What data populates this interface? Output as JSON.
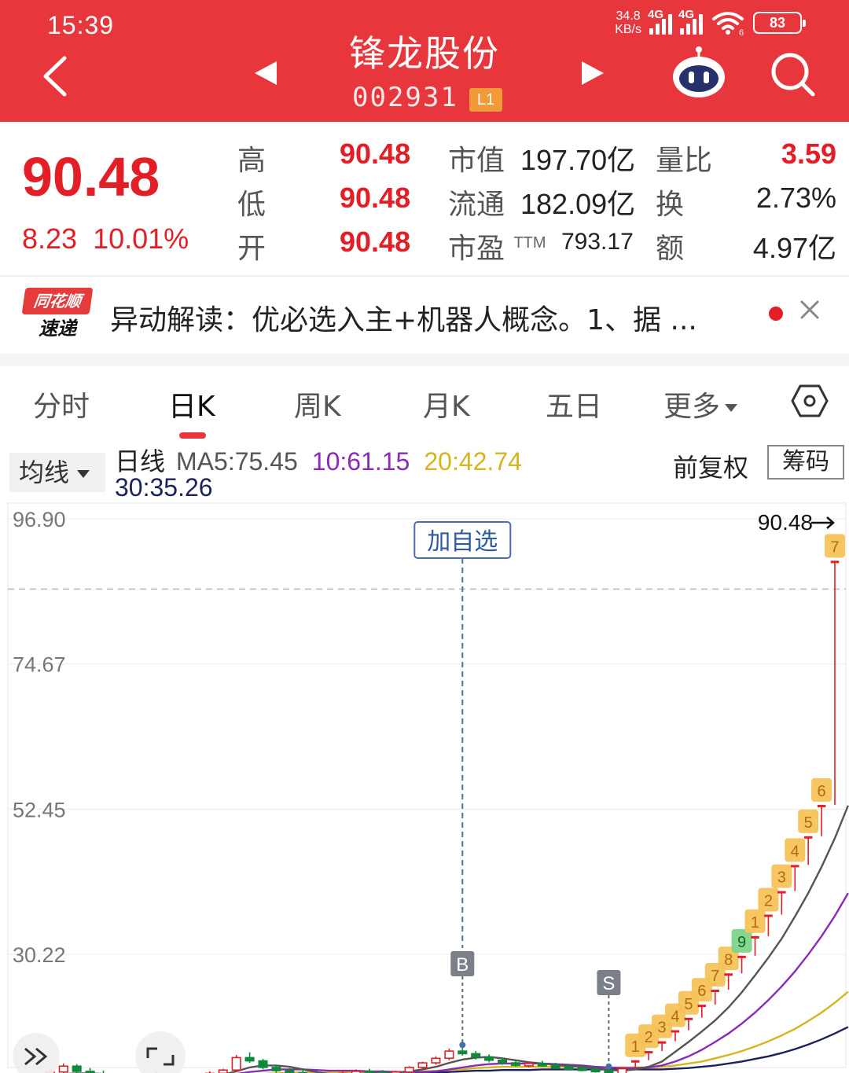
{
  "status_bar": {
    "time": "15:39",
    "net_speed_value": "34.8",
    "net_speed_unit": "KB/s",
    "network_1": "4G",
    "network_2": "4G",
    "wifi_badge": "6",
    "battery": "83"
  },
  "header": {
    "stock_name": "锋龙股份",
    "stock_code": "002931",
    "level_badge": "L1"
  },
  "quote": {
    "price": "90.48",
    "change": "8.23",
    "change_pct": "10.01%",
    "high_label": "高",
    "high": "90.48",
    "low_label": "低",
    "low": "90.48",
    "open_label": "开",
    "open": "90.48",
    "mcap_label": "市值",
    "mcap": "197.70亿",
    "float_label": "流通",
    "float": "182.09亿",
    "pe_label": "市盈",
    "pe_sup": "TTM",
    "pe": "793.17",
    "vol_ratio_label": "量比",
    "vol_ratio": "3.59",
    "turnover_label": "换",
    "turnover": "2.73%",
    "amount_label": "额",
    "amount": "4.97亿"
  },
  "news": {
    "logo_top": "同花顺",
    "logo_bottom": "速递",
    "text": "异动解读：优必选入主+机器人概念。1、据 ..."
  },
  "tabs": {
    "t1": "分时",
    "t2": "日K",
    "t3": "周K",
    "t4": "月K",
    "t5": "五日",
    "t6": "更多"
  },
  "ma_row": {
    "select_label": "均线",
    "name": "日线",
    "ma5": "MA5:75.45",
    "ma10": "10:61.15",
    "ma20": "20:42.74",
    "ma30": "30:35.26",
    "adjust_label": "前复权",
    "chips_button": "筹码"
  },
  "colors": {
    "brand": "#e8373c",
    "up": "#e21f26",
    "down": "#0e8a3a",
    "ma5": "#555555",
    "ma10": "#8a2ab8",
    "ma20": "#d7b41f",
    "ma30": "#1c2259",
    "badge": "#f6c35a"
  },
  "chart_data": {
    "type": "candlestick",
    "y_ticks": [
      "96.90",
      "74.67",
      "52.45",
      "30.22"
    ],
    "y_tick_values": [
      96.9,
      74.67,
      52.45,
      30.22
    ],
    "ylim": [
      10,
      96.9
    ],
    "price_guide": 90.48,
    "last_price_label": "90.48",
    "add_watch_label": "加自选",
    "buy_marker": {
      "label": "B",
      "index": 33
    },
    "sell_marker": {
      "label": "S",
      "index": 44
    },
    "candles": [
      {
        "o": 10.8,
        "h": 12.0,
        "l": 10.3,
        "c": 11.4
      },
      {
        "o": 11.4,
        "h": 11.9,
        "l": 10.6,
        "c": 10.9
      },
      {
        "o": 10.9,
        "h": 12.6,
        "l": 10.7,
        "c": 12.2
      },
      {
        "o": 12.2,
        "h": 13.5,
        "l": 11.8,
        "c": 13.1
      },
      {
        "o": 13.1,
        "h": 13.4,
        "l": 12.0,
        "c": 12.3
      },
      {
        "o": 12.3,
        "h": 12.8,
        "l": 11.5,
        "c": 11.9
      },
      {
        "o": 11.9,
        "h": 12.4,
        "l": 11.2,
        "c": 11.6
      },
      {
        "o": 11.6,
        "h": 12.0,
        "l": 11.0,
        "c": 11.3
      },
      {
        "o": 11.3,
        "h": 11.8,
        "l": 10.9,
        "c": 11.5
      },
      {
        "o": 11.5,
        "h": 12.1,
        "l": 11.1,
        "c": 11.8
      },
      {
        "o": 11.8,
        "h": 12.2,
        "l": 11.3,
        "c": 11.5
      },
      {
        "o": 11.5,
        "h": 11.9,
        "l": 11.0,
        "c": 11.2
      },
      {
        "o": 11.2,
        "h": 11.7,
        "l": 10.8,
        "c": 11.4
      },
      {
        "o": 11.4,
        "h": 11.9,
        "l": 11.1,
        "c": 11.7
      },
      {
        "o": 11.7,
        "h": 12.3,
        "l": 11.4,
        "c": 12.0
      },
      {
        "o": 12.0,
        "h": 12.7,
        "l": 11.6,
        "c": 12.5
      },
      {
        "o": 12.5,
        "h": 14.8,
        "l": 12.3,
        "c": 14.4
      },
      {
        "o": 14.4,
        "h": 15.2,
        "l": 13.6,
        "c": 13.9
      },
      {
        "o": 13.9,
        "h": 14.2,
        "l": 12.6,
        "c": 12.9
      },
      {
        "o": 12.9,
        "h": 13.3,
        "l": 12.1,
        "c": 12.4
      },
      {
        "o": 12.4,
        "h": 12.8,
        "l": 11.8,
        "c": 12.1
      },
      {
        "o": 12.1,
        "h": 12.6,
        "l": 11.6,
        "c": 11.8
      },
      {
        "o": 11.8,
        "h": 12.2,
        "l": 11.3,
        "c": 11.5
      },
      {
        "o": 11.5,
        "h": 12.0,
        "l": 11.1,
        "c": 11.7
      },
      {
        "o": 11.7,
        "h": 12.3,
        "l": 11.4,
        "c": 12.0
      },
      {
        "o": 12.0,
        "h": 12.6,
        "l": 11.7,
        "c": 12.3
      },
      {
        "o": 12.3,
        "h": 12.7,
        "l": 11.9,
        "c": 12.1
      },
      {
        "o": 12.1,
        "h": 12.5,
        "l": 11.6,
        "c": 11.9
      },
      {
        "o": 11.9,
        "h": 12.4,
        "l": 11.5,
        "c": 12.2
      },
      {
        "o": 12.2,
        "h": 13.1,
        "l": 12.0,
        "c": 12.9
      },
      {
        "o": 12.9,
        "h": 13.8,
        "l": 12.6,
        "c": 13.6
      },
      {
        "o": 13.6,
        "h": 14.6,
        "l": 13.3,
        "c": 14.3
      },
      {
        "o": 14.3,
        "h": 15.8,
        "l": 14.0,
        "c": 15.4
      },
      {
        "o": 15.4,
        "h": 16.1,
        "l": 14.7,
        "c": 15.0
      },
      {
        "o": 15.0,
        "h": 15.4,
        "l": 14.1,
        "c": 14.5
      },
      {
        "o": 14.5,
        "h": 14.9,
        "l": 13.7,
        "c": 14.0
      },
      {
        "o": 14.0,
        "h": 14.4,
        "l": 13.3,
        "c": 13.6
      },
      {
        "o": 13.6,
        "h": 14.0,
        "l": 13.0,
        "c": 13.3
      },
      {
        "o": 13.3,
        "h": 13.8,
        "l": 12.9,
        "c": 13.5
      },
      {
        "o": 13.5,
        "h": 13.9,
        "l": 13.0,
        "c": 13.2
      },
      {
        "o": 13.2,
        "h": 13.6,
        "l": 12.8,
        "c": 13.0
      },
      {
        "o": 13.0,
        "h": 13.4,
        "l": 12.5,
        "c": 12.8
      },
      {
        "o": 12.8,
        "h": 13.2,
        "l": 12.3,
        "c": 12.6
      },
      {
        "o": 12.6,
        "h": 13.0,
        "l": 12.1,
        "c": 12.4
      },
      {
        "o": 12.4,
        "h": 12.8,
        "l": 11.1,
        "c": 11.5
      },
      {
        "o": 11.5,
        "h": 12.9,
        "l": 11.3,
        "c": 12.7
      },
      {
        "o": 12.7,
        "h": 14.0,
        "l": 12.7,
        "c": 14.0,
        "badge": "1"
      },
      {
        "o": 14.0,
        "h": 15.4,
        "l": 14.0,
        "c": 15.4,
        "badge": "2"
      },
      {
        "o": 15.4,
        "h": 16.9,
        "l": 15.4,
        "c": 16.9,
        "badge": "3"
      },
      {
        "o": 16.9,
        "h": 18.6,
        "l": 16.9,
        "c": 18.6,
        "badge": "4"
      },
      {
        "o": 18.6,
        "h": 20.5,
        "l": 18.6,
        "c": 20.5,
        "badge": "5"
      },
      {
        "o": 20.5,
        "h": 22.5,
        "l": 20.5,
        "c": 22.5,
        "badge": "6"
      },
      {
        "o": 22.5,
        "h": 24.8,
        "l": 22.5,
        "c": 24.8,
        "badge": "7"
      },
      {
        "o": 24.8,
        "h": 27.3,
        "l": 24.8,
        "c": 27.3,
        "badge": "8"
      },
      {
        "o": 27.3,
        "h": 30.0,
        "l": 27.3,
        "c": 30.0,
        "badge": "9",
        "badge_color": "green"
      },
      {
        "o": 30.0,
        "h": 33.0,
        "l": 30.0,
        "c": 33.0,
        "badge": "1"
      },
      {
        "o": 33.0,
        "h": 36.3,
        "l": 33.0,
        "c": 36.3,
        "badge": "2"
      },
      {
        "o": 36.3,
        "h": 39.9,
        "l": 36.3,
        "c": 39.9,
        "badge": "3"
      },
      {
        "o": 39.9,
        "h": 43.9,
        "l": 39.9,
        "c": 43.9,
        "badge": "4"
      },
      {
        "o": 43.9,
        "h": 48.3,
        "l": 43.9,
        "c": 48.3,
        "badge": "5"
      },
      {
        "o": 48.3,
        "h": 53.1,
        "l": 48.3,
        "c": 53.1,
        "badge": "6"
      },
      {
        "o": 53.1,
        "h": 90.48,
        "l": 53.1,
        "c": 90.48,
        "badge": "7"
      }
    ],
    "ma5": [
      11.5,
      11.4,
      11.6,
      11.9,
      12.0,
      12.0,
      11.9,
      11.8,
      11.7,
      11.7,
      11.6,
      11.5,
      11.5,
      11.5,
      11.6,
      11.8,
      12.3,
      12.9,
      13.2,
      13.2,
      13.0,
      12.6,
      12.2,
      11.9,
      11.8,
      11.9,
      12.0,
      12.1,
      12.1,
      12.3,
      12.6,
      13.0,
      13.6,
      14.1,
      14.4,
      14.5,
      14.3,
      14.0,
      13.7,
      13.5,
      13.3,
      13.1,
      13.0,
      12.8,
      12.5,
      12.4,
      12.6,
      13.0,
      13.8,
      15.3,
      16.8,
      18.4,
      20.1,
      22.1,
      24.4,
      27.0,
      29.7,
      32.6,
      36.0,
      39.6,
      43.6,
      48.0,
      53.0
    ],
    "ma10": [
      11.3,
      11.3,
      11.4,
      11.5,
      11.6,
      11.7,
      11.7,
      11.7,
      11.7,
      11.7,
      11.7,
      11.6,
      11.6,
      11.6,
      11.6,
      11.7,
      11.9,
      12.2,
      12.4,
      12.6,
      12.6,
      12.6,
      12.5,
      12.4,
      12.4,
      12.4,
      12.3,
      12.3,
      12.2,
      12.2,
      12.2,
      12.3,
      12.6,
      12.9,
      13.2,
      13.4,
      13.5,
      13.5,
      13.5,
      13.5,
      13.4,
      13.3,
      13.2,
      13.0,
      12.9,
      12.8,
      12.8,
      12.9,
      13.2,
      13.8,
      14.6,
      15.6,
      16.8,
      18.1,
      19.6,
      21.3,
      23.2,
      25.3,
      27.6,
      30.2,
      33.0,
      36.1,
      39.6
    ],
    "ma20": [
      11.0,
      11.0,
      11.1,
      11.2,
      11.3,
      11.3,
      11.4,
      11.4,
      11.4,
      11.5,
      11.5,
      11.5,
      11.5,
      11.5,
      11.5,
      11.6,
      11.7,
      11.8,
      11.9,
      12.0,
      12.1,
      12.1,
      12.1,
      12.1,
      12.1,
      12.2,
      12.2,
      12.2,
      12.2,
      12.2,
      12.3,
      12.4,
      12.5,
      12.6,
      12.8,
      12.9,
      13.0,
      13.0,
      13.0,
      13.0,
      13.0,
      13.0,
      13.0,
      12.9,
      12.9,
      12.9,
      12.9,
      12.9,
      13.0,
      13.2,
      13.5,
      13.8,
      14.3,
      14.8,
      15.4,
      16.1,
      16.9,
      17.8,
      18.8,
      20.0,
      21.3,
      22.8,
      24.5
    ],
    "ma30": [
      10.8,
      10.8,
      10.9,
      11.0,
      11.0,
      11.1,
      11.1,
      11.2,
      11.2,
      11.2,
      11.3,
      11.3,
      11.3,
      11.3,
      11.4,
      11.4,
      11.5,
      11.5,
      11.6,
      11.7,
      11.7,
      11.8,
      11.8,
      11.8,
      11.9,
      11.9,
      11.9,
      12.0,
      12.0,
      12.0,
      12.1,
      12.1,
      12.2,
      12.3,
      12.4,
      12.4,
      12.5,
      12.5,
      12.5,
      12.6,
      12.6,
      12.6,
      12.6,
      12.6,
      12.6,
      12.6,
      12.6,
      12.6,
      12.6,
      12.7,
      12.8,
      13.0,
      13.2,
      13.5,
      13.8,
      14.2,
      14.6,
      15.1,
      15.7,
      16.4,
      17.2,
      18.1,
      19.1
    ]
  }
}
